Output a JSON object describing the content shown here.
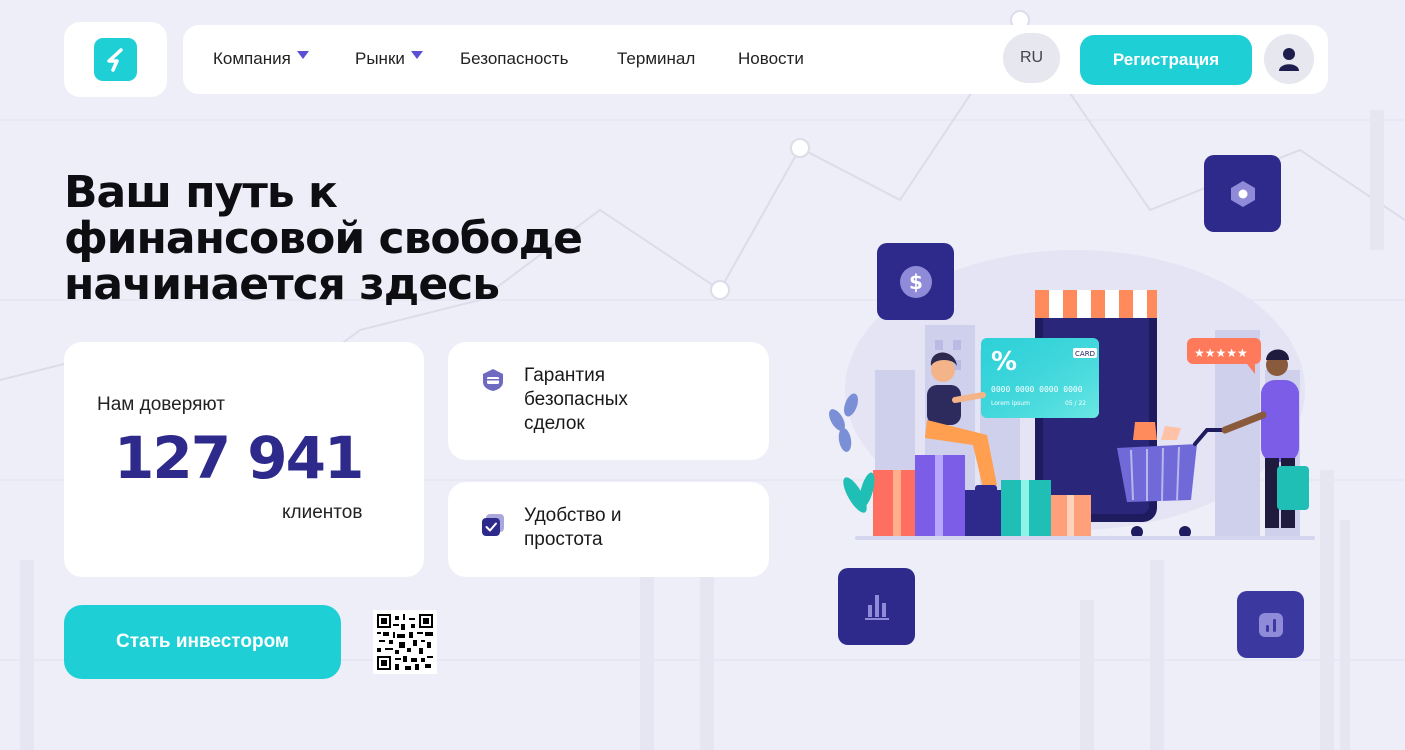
{
  "header": {
    "nav": [
      {
        "label": "Компания",
        "has_dropdown": true
      },
      {
        "label": "Рынки",
        "has_dropdown": true
      },
      {
        "label": "Безопасность",
        "has_dropdown": false
      },
      {
        "label": "Терминал",
        "has_dropdown": false
      },
      {
        "label": "Новости",
        "has_dropdown": false
      }
    ],
    "lang": "RU",
    "register_label": "Регистрация"
  },
  "hero": {
    "title_lines": [
      "Ваш путь к",
      "финансовой свободе",
      "начинается здесь"
    ],
    "trust": {
      "label": "Нам доверяют",
      "number": "127 941",
      "suffix": "клиентов"
    },
    "features": [
      {
        "lines": [
          "Гарантия",
          "безопасных",
          "сделок"
        ],
        "icon": "shield-card-icon"
      },
      {
        "lines": [
          "Удобство и",
          "простота"
        ],
        "icon": "check-square-icon"
      }
    ],
    "cta_label": "Стать инвестором",
    "qr": "qr-code-icon"
  },
  "illustration": {
    "card_brand": "CARD",
    "card_number": "0000 0000 0000 0000",
    "card_holder": "Lorem ipsum",
    "card_expiry": "05 / 22",
    "card_percent": "%",
    "rating_stars": 5
  },
  "colors": {
    "accent": "#1fcfd6",
    "brand_dark": "#2d2a8c",
    "background": "#eeeef8"
  }
}
